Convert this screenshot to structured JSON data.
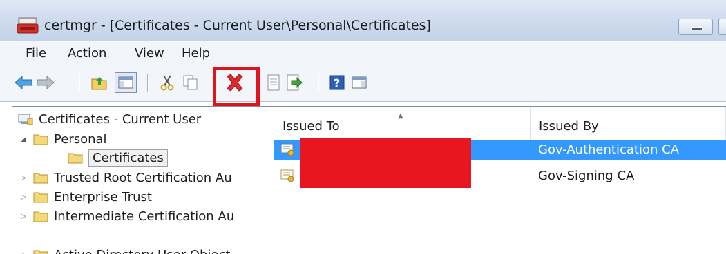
{
  "window": {
    "title": "certmgr - [Certificates - Current User\\Personal\\Certificates]"
  },
  "menu": [
    "File",
    "Action",
    "View",
    "Help"
  ],
  "toolbar": {
    "buttons": [
      "back-icon",
      "forward-icon",
      "up-folder-icon",
      "show-hide-tree-icon",
      "cut-icon",
      "copy-icon",
      "delete-icon",
      "properties-icon",
      "export-icon",
      "help-icon",
      "console-view-icon"
    ],
    "highlighted_button": "delete-icon",
    "highlight_color": "#e0141d"
  },
  "tree": {
    "root": "Certificates - Current User",
    "items": [
      {
        "label": "Personal",
        "state": "expanded"
      },
      {
        "label": "Certificates",
        "state": "selected"
      },
      {
        "label": "Trusted Root Certification Au",
        "state": "collapsed"
      },
      {
        "label": "Enterprise Trust",
        "state": "collapsed"
      },
      {
        "label": "Intermediate Certification Au",
        "state": "collapsed"
      },
      {
        "label": "Active Directory User Object",
        "state": "collapsed"
      }
    ]
  },
  "list": {
    "columns": [
      "Issued To",
      "Issued By"
    ],
    "sort_indicator": "ascending",
    "rows": [
      {
        "issued_to": "",
        "issued_by": "Gov-Authentication CA",
        "selected": true
      },
      {
        "issued_to": "",
        "issued_by": "Gov-Signing CA",
        "selected": false
      }
    ],
    "redaction_color": "#e8161f",
    "selection_color": "#3399ff"
  }
}
